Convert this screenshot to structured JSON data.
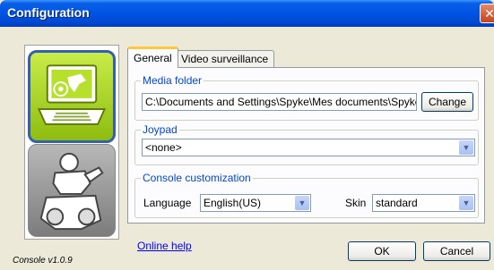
{
  "window": {
    "title": "Configuration",
    "close_glyph": "✕"
  },
  "left_panel": {
    "tiles": [
      {
        "name": "green-robot-tile",
        "icon": "robot-laptop-icon",
        "selected": true
      },
      {
        "name": "grey-robot-tile",
        "icon": "robot-icon",
        "selected": false
      }
    ]
  },
  "version": "Console v1.0.9",
  "tabs": [
    {
      "label": "General",
      "active": true
    },
    {
      "label": "Video surveillance",
      "active": false
    }
  ],
  "media_folder": {
    "title": "Media folder",
    "path": "C:\\Documents and Settings\\Spyke\\Mes documents\\Spykee",
    "change_label": "Change"
  },
  "joypad": {
    "title": "Joypad",
    "selected": "<none>"
  },
  "customization": {
    "title": "Console customization",
    "language_label": "Language",
    "language_value": "English(US)",
    "skin_label": "Skin",
    "skin_value": "standard"
  },
  "footer": {
    "help_link": "Online help",
    "ok_label": "OK",
    "cancel_label": "Cancel"
  },
  "colors": {
    "titlebar": "#0055e5",
    "group_title": "#0046d5",
    "link": "#0000ff",
    "tile_green": "#a8d420"
  }
}
